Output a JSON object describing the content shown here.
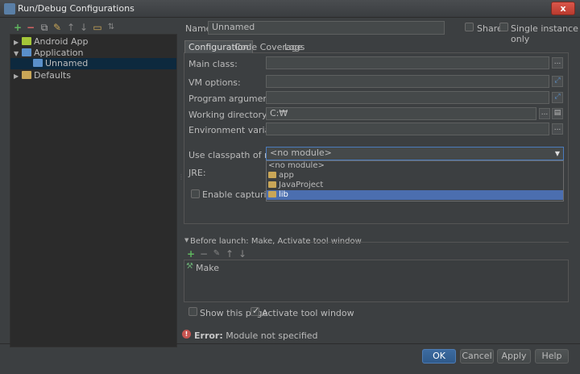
{
  "window": {
    "title": "Run/Debug Configurations",
    "close_label": "x"
  },
  "tree": {
    "items": [
      {
        "label": "Android App"
      },
      {
        "label": "Application"
      },
      {
        "label": "Unnamed"
      },
      {
        "label": "Defaults"
      }
    ]
  },
  "header": {
    "name_label": "Name:",
    "name_value": "Unnamed",
    "share_label": "Share",
    "single_instance_label": "Single instance only"
  },
  "tabs": [
    {
      "label": "Configuration"
    },
    {
      "label": "Code Coverage"
    },
    {
      "label": "Logs"
    }
  ],
  "form": {
    "main_class_label": "Main class:",
    "main_class_value": "",
    "vm_options_label": "VM options:",
    "vm_options_value": "",
    "program_args_label": "Program arguments:",
    "program_args_value": "",
    "working_dir_label": "Working directory:",
    "working_dir_value": "C:₩",
    "env_vars_label": "Environment variables:",
    "env_vars_value": "",
    "classpath_label": "Use classpath of module:",
    "classpath_selected": "<no module>",
    "jre_label": "JRE:",
    "enable_capturing_label": "Enable capturing form"
  },
  "dropdown": {
    "options": [
      {
        "label": "<no module>"
      },
      {
        "label": "app"
      },
      {
        "label": "JavaProject"
      },
      {
        "label": "lib"
      }
    ]
  },
  "before_launch": {
    "header": "Before launch: Make, Activate tool window",
    "tasks": [
      {
        "label": "Make"
      }
    ],
    "show_page_label": "Show this page",
    "activate_window_label": "Activate tool window"
  },
  "error": {
    "prefix": "Error:",
    "message": "Module not specified"
  },
  "buttons": {
    "ok": "OK",
    "cancel": "Cancel",
    "apply": "Apply",
    "help": "Help"
  },
  "colors": {
    "background": "#3c3f41",
    "selection": "#4b6eaf",
    "primary_button": "#365880",
    "error": "#c75450"
  }
}
